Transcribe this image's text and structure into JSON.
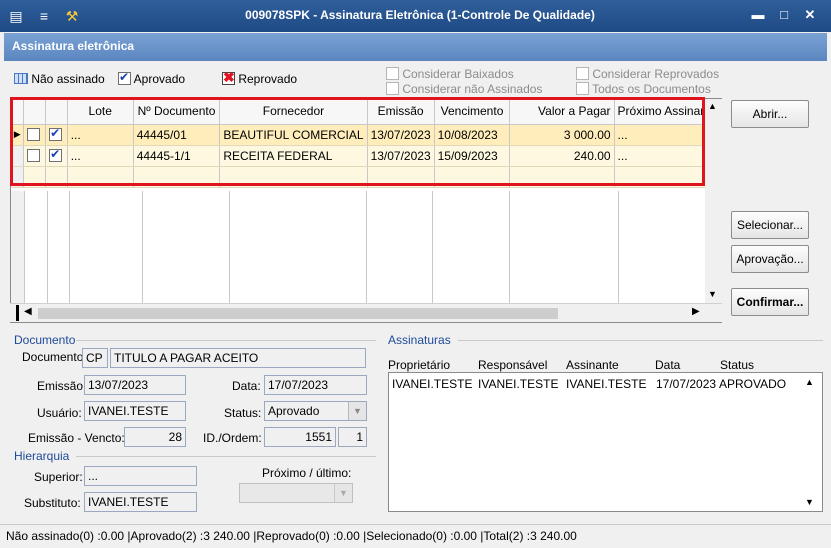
{
  "window": {
    "title": "009078SPK - Assinatura Eletrônica (1-Controle De Qualidade)",
    "subheader": "Assinatura eletrônica",
    "controls": {
      "minimize": "▬",
      "maximize": "□",
      "close": "✕"
    }
  },
  "legend": {
    "nao_assinado": "Não assinado",
    "aprovado": "Aprovado",
    "reprovado": "Reprovado"
  },
  "filters": {
    "considerar_baixados": "Considerar Baixados",
    "considerar_nao_assinados": "Considerar não Assinados",
    "considerar_reprovados": "Considerar Reprovados",
    "todos_documentos": "Todos os Documentos"
  },
  "grid": {
    "columns": [
      "Lote",
      "Nº Documento",
      "Fornecedor",
      "Emissão",
      "Vencimento",
      "Valor a Pagar",
      "Próximo Assinante"
    ],
    "rows": [
      {
        "lote": "...",
        "documento": "44445/01",
        "fornecedor": "BEAUTIFUL COMERCIAL",
        "emissao": "13/07/2023",
        "vencimento": "10/08/2023",
        "valor": "3 000.00",
        "proximo": "..."
      },
      {
        "lote": "...",
        "documento": "44445-1/1",
        "fornecedor": "RECEITA FEDERAL",
        "emissao": "13/07/2023",
        "vencimento": "15/09/2023",
        "valor": "240.00",
        "proximo": "..."
      }
    ]
  },
  "buttons": {
    "abrir": "Abrir...",
    "selecionar": "Selecionar...",
    "aprovacao": "Aprovação...",
    "confirmar": "Confirmar..."
  },
  "documento": {
    "section": "Documento",
    "documento_label": "Documento:",
    "documento_tipo": "CP",
    "documento_desc": "TITULO A PAGAR ACEITO",
    "emissao_label": "Emissão:",
    "emissao": "13/07/2023",
    "data_label": "Data:",
    "data": "17/07/2023",
    "usuario_label": "Usuário:",
    "usuario": "IVANEI.TESTE",
    "status_label": "Status:",
    "status": "Aprovado",
    "emissao_vencto_label": "Emissão - Vencto:",
    "emissao_vencto": "28",
    "id_ordem_label": "ID./Ordem:",
    "id": "1551",
    "ordem": "1"
  },
  "hierarquia": {
    "section": "Hierarquia",
    "superior_label": "Superior:",
    "superior": "...",
    "substituto_label": "Substituto:",
    "substituto": "IVANEI.TESTE",
    "proximo_label": "Próximo / último:"
  },
  "assinaturas": {
    "section": "Assinaturas",
    "columns": [
      "Proprietário",
      "Responsável",
      "Assinante",
      "Data",
      "Status"
    ],
    "rows": [
      {
        "proprietario": "IVANEI.TESTE",
        "responsavel": "IVANEI.TESTE",
        "assinante": "IVANEI.TESTE",
        "data": "17/07/2023",
        "status": "APROVADO"
      }
    ]
  },
  "statusbar": {
    "text": "Não assinado(0) :0.00 |Aprovado(2) :3 240.00 |Reprovado(0) :0.00 |Selecionado(0) :0.00 |Total(2) :3 240.00"
  },
  "colors": {
    "title_bg": "#1f4a85",
    "highlight": "#e0141e",
    "row_bg": "#fff8e0"
  }
}
